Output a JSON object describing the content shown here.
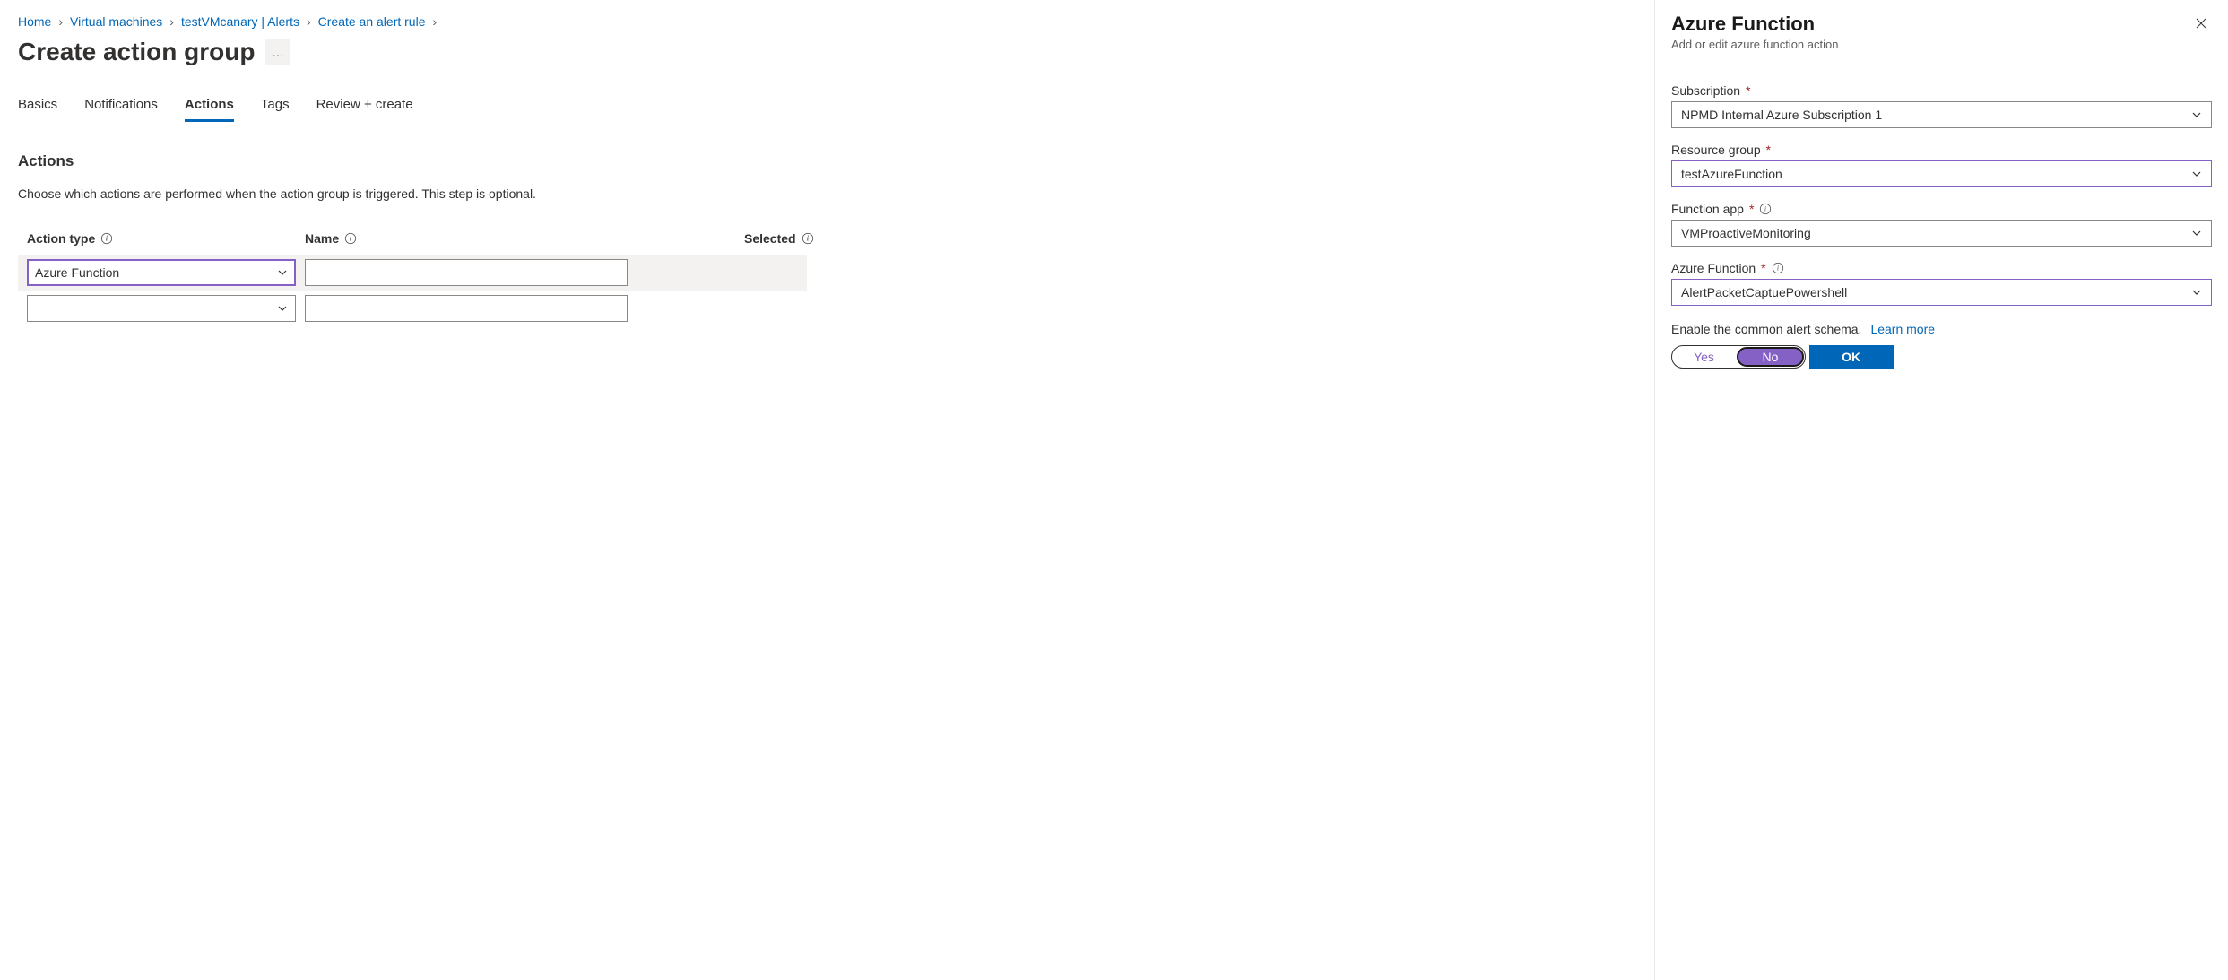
{
  "breadcrumb": {
    "items": [
      "Home",
      "Virtual machines",
      "testVMcanary | Alerts",
      "Create an alert rule"
    ]
  },
  "page": {
    "title": "Create action group",
    "more": "…"
  },
  "tabs": {
    "items": [
      {
        "label": "Basics",
        "active": false
      },
      {
        "label": "Notifications",
        "active": false
      },
      {
        "label": "Actions",
        "active": true
      },
      {
        "label": "Tags",
        "active": false
      },
      {
        "label": "Review + create",
        "active": false
      }
    ]
  },
  "section": {
    "title": "Actions",
    "desc": "Choose which actions are performed when the action group is triggered. This step is optional."
  },
  "table": {
    "headers": {
      "action_type": "Action type",
      "name": "Name",
      "selected": "Selected"
    },
    "rows": [
      {
        "action_type": "Azure Function",
        "name": ""
      },
      {
        "action_type": "",
        "name": ""
      }
    ]
  },
  "panel": {
    "title": "Azure Function",
    "subtitle": "Add or edit azure function action",
    "fields": {
      "subscription": {
        "label": "Subscription",
        "value": "NPMD Internal Azure Subscription 1"
      },
      "resource_group": {
        "label": "Resource group",
        "value": "testAzureFunction"
      },
      "function_app": {
        "label": "Function app",
        "value": "VMProactiveMonitoring"
      },
      "azure_function": {
        "label": "Azure Function",
        "value": "AlertPacketCaptuePowershell"
      }
    },
    "schema": {
      "text": "Enable the common alert schema.",
      "link": "Learn more",
      "yes": "Yes",
      "no": "No"
    },
    "ok": "OK"
  }
}
